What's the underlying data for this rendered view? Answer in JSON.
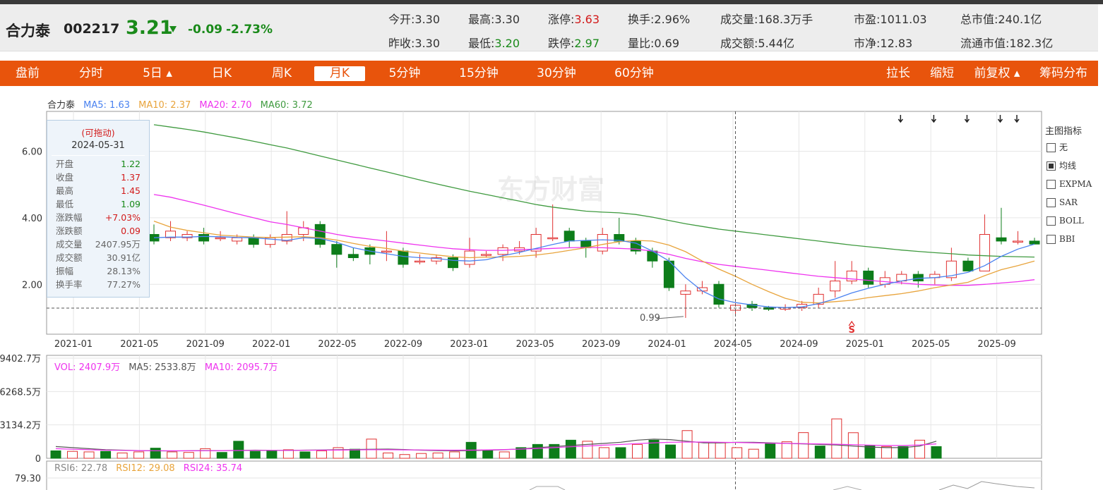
{
  "stock": {
    "name": "合力泰",
    "code": "002217",
    "price": "3.21",
    "change": "-0.09",
    "change_pct": "-2.73%"
  },
  "quote_fields": [
    {
      "key": "今开:",
      "value": "3.30",
      "color": ""
    },
    {
      "key": "最高:",
      "value": "3.30",
      "color": ""
    },
    {
      "key": "涨停:",
      "value": "3.63",
      "color": "up"
    },
    {
      "key": "换手:",
      "value": "2.96%",
      "color": ""
    },
    {
      "key": "成交量:",
      "value": "168.3万手",
      "color": ""
    },
    {
      "key": "市盈:",
      "value": "1011.03",
      "color": ""
    },
    {
      "key": "总市值:",
      "value": "240.1亿",
      "color": ""
    },
    {
      "key": "昨收:",
      "value": "3.30",
      "color": ""
    },
    {
      "key": "最低:",
      "value": "3.20",
      "color": "down"
    },
    {
      "key": "跌停:",
      "value": "2.97",
      "color": "down"
    },
    {
      "key": "量比:",
      "value": "0.69",
      "color": ""
    },
    {
      "key": "成交额:",
      "value": "5.44亿",
      "color": ""
    },
    {
      "key": "市净:",
      "value": "12.83",
      "color": ""
    },
    {
      "key": "流通市值:",
      "value": "182.3亿",
      "color": ""
    }
  ],
  "tabs": {
    "premarket": "盘前",
    "intraday": "分时",
    "five_day": "5日 ▴",
    "daily": "日K",
    "weekly": "周K",
    "monthly": "月K",
    "m5": "5分钟",
    "m15": "15分钟",
    "m30": "30分钟",
    "m60": "60分钟",
    "stretch": "拉长",
    "shrink": "缩短",
    "adjust": "前复权 ▴",
    "chips": "筹码分布"
  },
  "legend_main": {
    "name": "合力泰",
    "ma5": "MA5: 1.63",
    "ma10": "MA10: 2.37",
    "ma20": "MA20: 2.70",
    "ma60": "MA60: 3.72"
  },
  "legend_vol": {
    "vol": "VOL: 2407.9万",
    "ma5": "MA5: 2533.8万",
    "ma10": "MA10: 2095.7万"
  },
  "legend_rsi": {
    "rsi6": "RSI6: 22.78",
    "rsi12": "RSI12: 29.08",
    "rsi24": "RSI24: 35.74"
  },
  "tooltip": {
    "title": "(可拖动)",
    "date": "2024-05-31",
    "rows": [
      {
        "k": "开盘",
        "v": "1.22",
        "c": "green"
      },
      {
        "k": "收盘",
        "v": "1.37",
        "c": "red"
      },
      {
        "k": "最高",
        "v": "1.45",
        "c": "red"
      },
      {
        "k": "最低",
        "v": "1.09",
        "c": "green"
      },
      {
        "k": "涨跌幅",
        "v": "+7.03%",
        "c": "red"
      },
      {
        "k": "涨跌额",
        "v": "0.09",
        "c": "red"
      },
      {
        "k": "成交量",
        "v": "2407.95万",
        "c": "gray"
      },
      {
        "k": "成交额",
        "v": "30.91亿",
        "c": "gray"
      },
      {
        "k": "振幅",
        "v": "28.13%",
        "c": "gray"
      },
      {
        "k": "换手率",
        "v": "77.27%",
        "c": "gray"
      }
    ]
  },
  "indicator_panel": {
    "title": "主图指标",
    "items": [
      {
        "label": "无",
        "checked": false
      },
      {
        "label": "均线",
        "checked": true
      },
      {
        "label": "EXPMA",
        "checked": false
      },
      {
        "label": "SAR",
        "checked": false
      },
      {
        "label": "BOLL",
        "checked": false
      },
      {
        "label": "BBI",
        "checked": false
      }
    ]
  },
  "watermark": "东方财富",
  "annotations": {
    "low_label": "0.99",
    "signal": "S"
  },
  "colors": {
    "up": "#e03030",
    "down": "#0d7d1a",
    "ma5": "#4a82f0",
    "ma10": "#e8a43c",
    "ma20": "#ee33ee",
    "ma60": "#3f9a3f",
    "accent": "#e8540c"
  },
  "chart_data": {
    "type": "candlestick",
    "price_axis": {
      "ticks": [
        2.0,
        4.0,
        6.0
      ]
    },
    "x_ticks": [
      "2021-01",
      "2021-05",
      "2021-09",
      "2022-01",
      "2022-05",
      "2022-09",
      "2023-01",
      "2023-05",
      "2023-09",
      "2024-01",
      "2024-05",
      "2024-09",
      "2025-01",
      "2025-05",
      "2025-09"
    ],
    "candles": [
      [
        3.5,
        3.3,
        3.8,
        3.2
      ],
      [
        3.4,
        3.6,
        3.9,
        3.3
      ],
      [
        3.4,
        3.5,
        3.6,
        3.3
      ],
      [
        3.5,
        3.3,
        3.7,
        3.2
      ],
      [
        3.4,
        3.4,
        3.6,
        3.3
      ],
      [
        3.3,
        3.4,
        3.5,
        3.2
      ],
      [
        3.4,
        3.2,
        3.5,
        3.1
      ],
      [
        3.2,
        3.4,
        3.5,
        3.1
      ],
      [
        3.3,
        3.5,
        4.2,
        3.2
      ],
      [
        3.5,
        3.7,
        3.9,
        3.3
      ],
      [
        3.8,
        3.2,
        3.9,
        3.1
      ],
      [
        3.2,
        2.9,
        3.3,
        2.5
      ],
      [
        2.9,
        2.8,
        3.1,
        2.7
      ],
      [
        3.1,
        2.9,
        3.2,
        2.6
      ],
      [
        3.0,
        3.0,
        3.6,
        2.7
      ],
      [
        3.0,
        2.6,
        3.1,
        2.5
      ],
      [
        2.7,
        2.7,
        2.9,
        2.6
      ],
      [
        2.7,
        2.8,
        2.9,
        2.6
      ],
      [
        2.8,
        2.5,
        2.9,
        2.4
      ],
      [
        2.6,
        3.0,
        3.4,
        2.5
      ],
      [
        2.9,
        2.9,
        3.0,
        2.8
      ],
      [
        2.9,
        3.1,
        3.2,
        2.7
      ],
      [
        3.0,
        3.1,
        3.3,
        2.9
      ],
      [
        3.0,
        3.5,
        3.7,
        2.8
      ],
      [
        3.4,
        3.4,
        4.4,
        3.3
      ],
      [
        3.6,
        3.3,
        3.7,
        3.1
      ],
      [
        3.3,
        3.1,
        3.4,
        2.8
      ],
      [
        3.0,
        3.5,
        3.7,
        2.9
      ],
      [
        3.5,
        3.3,
        4.0,
        3.2
      ],
      [
        3.3,
        3.0,
        3.4,
        2.9
      ],
      [
        3.0,
        2.7,
        3.1,
        2.5
      ],
      [
        2.7,
        1.9,
        2.8,
        1.8
      ],
      [
        1.7,
        1.8,
        2.0,
        0.99
      ],
      [
        1.8,
        1.9,
        2.1,
        1.7
      ],
      [
        2.0,
        1.4,
        2.1,
        1.3
      ],
      [
        1.22,
        1.37,
        1.45,
        1.09
      ],
      [
        1.4,
        1.3,
        1.5,
        1.2
      ],
      [
        1.3,
        1.25,
        1.35,
        1.2
      ],
      [
        1.25,
        1.3,
        1.4,
        1.2
      ],
      [
        1.3,
        1.4,
        1.5,
        1.2
      ],
      [
        1.4,
        1.7,
        1.9,
        1.3
      ],
      [
        1.8,
        2.1,
        2.7,
        1.6
      ],
      [
        2.1,
        2.4,
        2.7,
        2.0
      ],
      [
        2.4,
        2.0,
        2.5,
        1.9
      ],
      [
        2.0,
        2.2,
        2.4,
        1.9
      ],
      [
        2.1,
        2.3,
        2.4,
        2.0
      ],
      [
        2.3,
        2.1,
        2.4,
        1.9
      ],
      [
        2.2,
        2.3,
        2.4,
        2.0
      ],
      [
        2.2,
        2.7,
        3.1,
        2.1
      ],
      [
        2.7,
        2.4,
        2.8,
        2.4
      ],
      [
        2.4,
        3.5,
        4.1,
        2.4
      ],
      [
        3.4,
        3.3,
        4.3,
        3.2
      ],
      [
        3.3,
        3.3,
        3.6,
        3.2
      ],
      [
        3.3,
        3.21,
        3.4,
        3.2
      ]
    ],
    "ma5": [
      3.4,
      3.42,
      3.42,
      3.44,
      3.43,
      3.41,
      3.4,
      3.36,
      3.32,
      3.4,
      3.38,
      3.26,
      3.1,
      3.0,
      2.92,
      2.84,
      2.8,
      2.78,
      2.72,
      2.7,
      2.74,
      2.86,
      2.96,
      3.08,
      3.2,
      3.3,
      3.32,
      3.34,
      3.32,
      3.24,
      3.0,
      2.7,
      2.2,
      1.8,
      1.56,
      1.45,
      1.38,
      1.32,
      1.3,
      1.32,
      1.42,
      1.56,
      1.74,
      1.88,
      2.0,
      2.1,
      2.18,
      2.2,
      2.26,
      2.36,
      2.56,
      2.84,
      3.06,
      3.21
    ],
    "ma10": [
      3.9,
      3.72,
      3.62,
      3.55,
      3.48,
      3.45,
      3.42,
      3.41,
      3.42,
      3.43,
      3.4,
      3.33,
      3.23,
      3.14,
      3.08,
      3.0,
      2.94,
      2.88,
      2.83,
      2.8,
      2.82,
      2.82,
      2.84,
      2.88,
      2.94,
      3.02,
      3.1,
      3.2,
      3.28,
      3.32,
      3.3,
      3.18,
      2.98,
      2.7,
      2.46,
      2.24,
      2.0,
      1.78,
      1.58,
      1.46,
      1.44,
      1.48,
      1.52,
      1.6,
      1.66,
      1.72,
      1.8,
      1.9,
      1.98,
      2.06,
      2.26,
      2.44,
      2.56,
      2.7
    ],
    "ma20": [
      4.7,
      4.62,
      4.5,
      4.38,
      4.25,
      4.12,
      4.0,
      3.88,
      3.8,
      3.7,
      3.6,
      3.5,
      3.42,
      3.36,
      3.3,
      3.24,
      3.18,
      3.12,
      3.07,
      3.04,
      3.02,
      3.02,
      3.04,
      3.06,
      3.08,
      3.1,
      3.11,
      3.1,
      3.08,
      3.06,
      3.0,
      2.9,
      2.78,
      2.68,
      2.6,
      2.54,
      2.48,
      2.42,
      2.36,
      2.3,
      2.24,
      2.2,
      2.16,
      2.12,
      2.08,
      2.04,
      2.0,
      1.98,
      1.97,
      1.97,
      2.0,
      2.04,
      2.08,
      2.14
    ],
    "ma60": [
      6.8,
      6.73,
      6.66,
      6.58,
      6.49,
      6.4,
      6.3,
      6.2,
      6.1,
      5.98,
      5.86,
      5.74,
      5.62,
      5.5,
      5.38,
      5.26,
      5.14,
      5.02,
      4.91,
      4.8,
      4.7,
      4.6,
      4.5,
      4.4,
      4.32,
      4.26,
      4.2,
      4.17,
      4.15,
      4.1,
      4.02,
      3.92,
      3.82,
      3.74,
      3.66,
      3.6,
      3.54,
      3.48,
      3.42,
      3.36,
      3.3,
      3.24,
      3.18,
      3.13,
      3.08,
      3.03,
      2.99,
      2.95,
      2.92,
      2.88,
      2.86,
      2.84,
      2.83,
      2.82
    ],
    "volume_axis": {
      "ticks": [
        "0",
        "3134.2万",
        "6268.5万",
        "9402.7万"
      ]
    },
    "volumes": [
      700,
      650,
      600,
      650,
      500,
      600,
      950,
      600,
      550,
      900,
      550,
      1600,
      650,
      700,
      800,
      600,
      700,
      1000,
      850,
      1800,
      500,
      350,
      450,
      500,
      600,
      1500,
      750,
      600,
      1000,
      1300,
      1300,
      1700,
      1600,
      1000,
      1000,
      1300,
      1700,
      1250,
      2600,
      1500,
      1450,
      1000,
      850,
      1400,
      1550,
      2408,
      1150,
      3700,
      2400,
      1200,
      1100,
      1100,
      1700,
      1100
    ],
    "vol_ma5": [
      1100,
      1000,
      900,
      800,
      760,
      720,
      700,
      680,
      700,
      720,
      720,
      740,
      760,
      740,
      740,
      760,
      780,
      800,
      820,
      850,
      860,
      820,
      760,
      720,
      700,
      720,
      760,
      800,
      880,
      1000,
      1100,
      1200,
      1300,
      1400,
      1500,
      1700,
      1800,
      1750,
      1600,
      1450,
      1450,
      1500,
      1500,
      1450,
      1400,
      1350,
      1300,
      1250,
      1150,
      1050,
      1000,
      1000,
      1150,
      1600
    ],
    "vol_ma10": [
      900,
      850,
      800,
      760,
      740,
      720,
      710,
      700,
      700,
      710,
      720,
      730,
      740,
      740,
      740,
      750,
      760,
      770,
      790,
      800,
      800,
      790,
      780,
      770,
      760,
      770,
      790,
      820,
      860,
      920,
      1000,
      1080,
      1150,
      1230,
      1300,
      1380,
      1450,
      1500,
      1520,
      1520,
      1500,
      1480,
      1450,
      1420,
      1400,
      1380,
      1350,
      1320,
      1280,
      1230,
      1200,
      1200,
      1250,
      1350
    ],
    "rsi_axis": {
      "ticks": [
        "79.30"
      ]
    },
    "rsi6": 22.78,
    "rsi12": 29.08,
    "rsi24": 35.74
  }
}
